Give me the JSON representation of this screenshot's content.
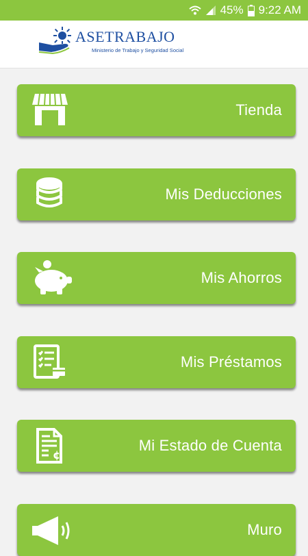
{
  "status_bar": {
    "battery_percent": "45%",
    "time": "9:22 AM"
  },
  "header": {
    "logo_title": "ASETRABAJO",
    "logo_subtitle": "Ministerio de Trabajo y Seguridad Social"
  },
  "colors": {
    "brand_green": "#8cc63f",
    "logo_blue": "#1e4fa1"
  },
  "menu": {
    "items": [
      {
        "label": "Tienda",
        "icon": "store-icon"
      },
      {
        "label": "Mis Deducciones",
        "icon": "coins-icon"
      },
      {
        "label": "Mis Ahorros",
        "icon": "piggy-bank-icon"
      },
      {
        "label": "Mis Préstamos",
        "icon": "loan-document-icon"
      },
      {
        "label": "Mi Estado de Cuenta",
        "icon": "account-statement-icon"
      },
      {
        "label": "Muro",
        "icon": "megaphone-icon"
      }
    ]
  }
}
